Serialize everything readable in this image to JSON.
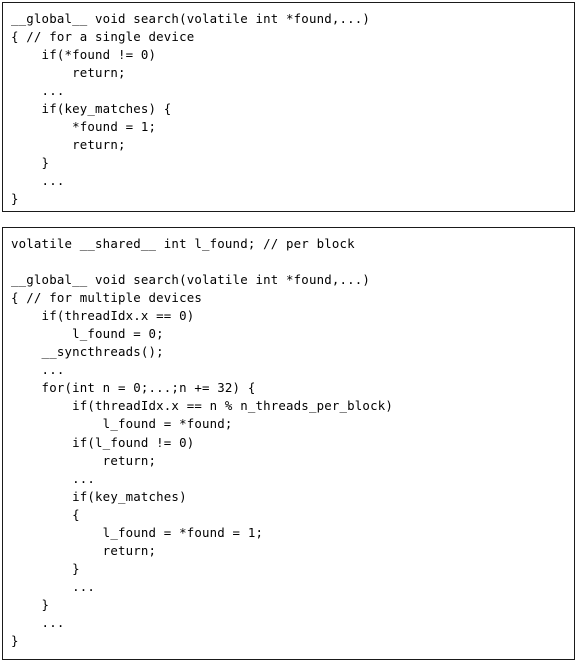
{
  "figure": {
    "kind": "code-listing-pair",
    "background_color": "#ffffff",
    "border_color": "#1a1a1a",
    "text_color": "#000000"
  },
  "listings": [
    {
      "id": "single-device",
      "caption_comment": "// for a single device",
      "lines": [
        "__global__ void search(volatile int *found,...)",
        "{ // for a single device",
        "    if(*found != 0)",
        "        return;",
        "    ...",
        "    if(key_matches) {",
        "        *found = 1;",
        "        return;",
        "    }",
        "    ...",
        "}"
      ]
    },
    {
      "id": "multiple-devices",
      "caption_comment": "// for multiple devices",
      "lines": [
        "volatile __shared__ int l_found; // per block",
        "",
        "__global__ void search(volatile int *found,...)",
        "{ // for multiple devices",
        "    if(threadIdx.x == 0)",
        "        l_found = 0;",
        "    __syncthreads();",
        "    ...",
        "    for(int n = 0;...;n += 32) {",
        "        if(threadIdx.x == n % n_threads_per_block)",
        "            l_found = *found;",
        "        if(l_found != 0)",
        "            return;",
        "        ...",
        "        if(key_matches)",
        "        {",
        "            l_found = *found = 1;",
        "            return;",
        "        }",
        "        ...",
        "    }",
        "    ...",
        "}"
      ]
    }
  ]
}
